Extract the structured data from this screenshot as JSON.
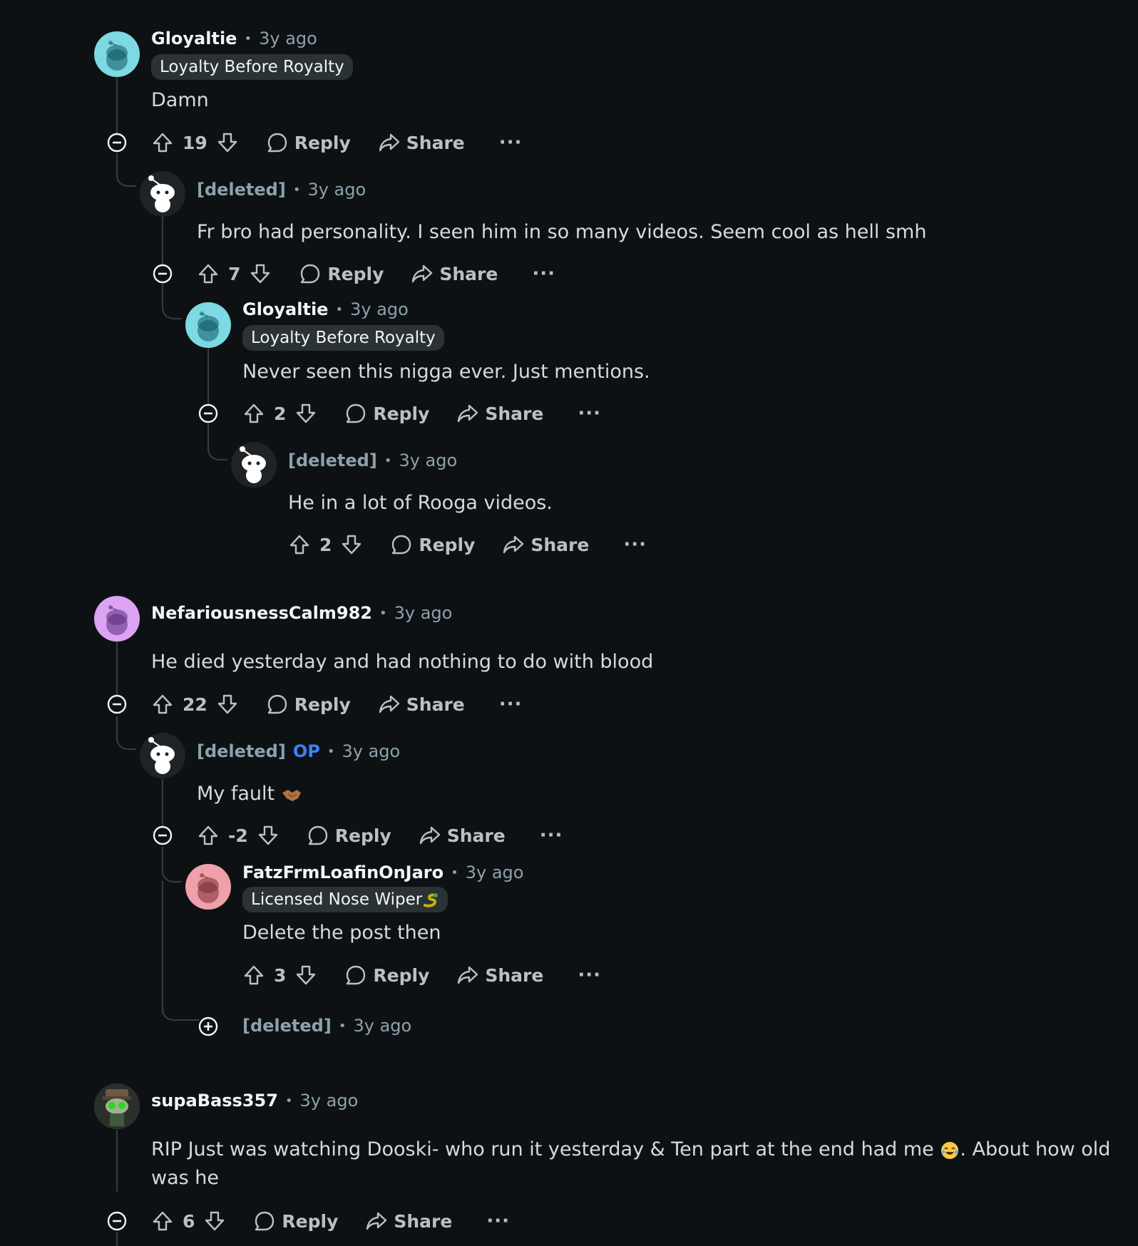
{
  "comments": [
    {
      "author": "Gloyaltie",
      "time": "3y ago",
      "flair": "Loyalty Before Royalty",
      "body": "Damn",
      "score": "19"
    },
    {
      "author": "[deleted]",
      "time": "3y ago",
      "body": "Fr bro had personality. I seen him in so many videos. Seem cool as hell smh",
      "score": "7"
    },
    {
      "author": "Gloyaltie",
      "time": "3y ago",
      "flair": "Loyalty Before Royalty",
      "body": "Never seen this nigga ever. Just mentions.",
      "score": "2"
    },
    {
      "author": "[deleted]",
      "time": "3y ago",
      "body": "He in a lot of Rooga videos.",
      "score": "2"
    },
    {
      "author": "NefariousnessCalm982",
      "time": "3y ago",
      "body": "He died yesterday and had nothing to do with blood",
      "score": "22"
    },
    {
      "author": "[deleted]",
      "op": "OP",
      "time": "3y ago",
      "body": "My fault",
      "score": "-2"
    },
    {
      "author": "FatzFrmLoafinOnJaro",
      "time": "3y ago",
      "flair": "Licensed Nose Wiper",
      "body": "Delete the post then",
      "score": "3"
    },
    {
      "author": "[deleted]",
      "time": "3y ago"
    },
    {
      "author": "supaBass357",
      "time": "3y ago",
      "body": "RIP Just was watching Dooski- who run it yesterday & Ten part at the end had me",
      "body_end": ". About how old was he",
      "score": "6"
    }
  ],
  "labels": {
    "reply": "Reply",
    "share": "Share",
    "more": "···",
    "dot": "•"
  },
  "icons": [
    "upvote-icon",
    "downvote-icon",
    "reply-icon",
    "share-icon",
    "collapse-icon",
    "expand-icon",
    "handshake-emoji",
    "laughing-emoji",
    "snake-emoji"
  ],
  "colors": {
    "background": "#0e1113",
    "text": "#d7dadc",
    "meta": "#8ba2ad",
    "flair_bg": "#2a3236",
    "op": "#3b82f6",
    "teal_avatar": "#7dd9e3",
    "purple_avatar": "#dba3f2",
    "pink_avatar": "#f0a0aa"
  }
}
